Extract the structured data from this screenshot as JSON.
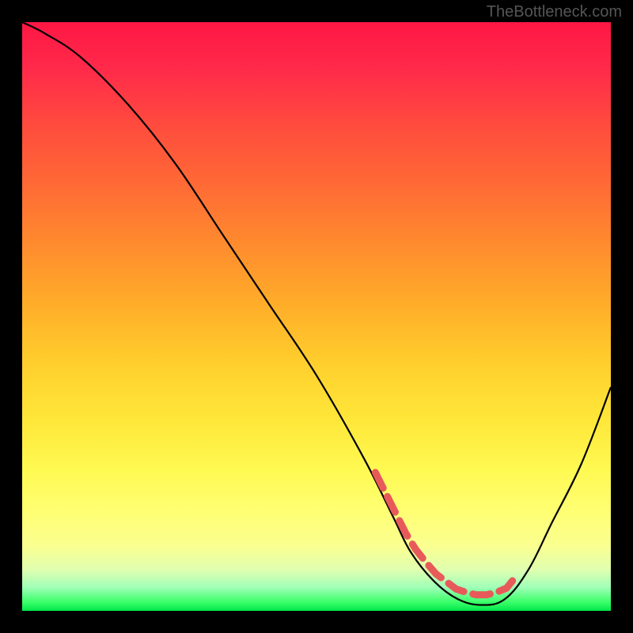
{
  "watermark": "TheBottleneck.com",
  "chart_data": {
    "type": "line",
    "title": "",
    "xlabel": "",
    "ylabel": "",
    "xlim": [
      0,
      100
    ],
    "ylim": [
      0,
      100
    ],
    "series": [
      {
        "name": "curve",
        "x": [
          0,
          4,
          10,
          18,
          26,
          34,
          42,
          50,
          58,
          63,
          66,
          70,
          74,
          78,
          82,
          86,
          90,
          95,
          100
        ],
        "y": [
          100,
          98,
          94,
          86,
          76,
          64,
          52,
          40,
          26,
          16,
          10,
          5,
          2,
          1,
          2,
          7,
          15,
          25,
          38
        ]
      }
    ],
    "highlight_range_x": [
      60,
      84
    ],
    "gradient_stops": [
      {
        "pos": 0.0,
        "color": "#ff1744"
      },
      {
        "pos": 0.5,
        "color": "#ffcf2d"
      },
      {
        "pos": 0.85,
        "color": "#ffff72"
      },
      {
        "pos": 1.0,
        "color": "#00e84a"
      }
    ]
  }
}
